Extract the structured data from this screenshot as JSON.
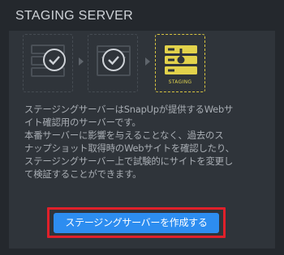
{
  "header": {
    "title": "STAGING SERVER"
  },
  "steps": [
    {
      "label": "",
      "state": "done"
    },
    {
      "label": "",
      "state": "done"
    },
    {
      "label": "STAGING",
      "state": "current"
    }
  ],
  "description": "ステージングサーバーはSnapUpが提供するWebサ\nイト確認用のサーバーです。\n本番サーバーに影響を与えることなく、過去のス\nナップショット取得時のWebサイトを確認したり、\nステージングサーバー上で試験的にサイトを変更し\nて検証することができます。",
  "actions": {
    "create_button_label": "ステージングサーバーを作成する"
  },
  "colors": {
    "accent": "#2d8df0",
    "highlight_outline": "#e0202a",
    "current_step": "#d8c440"
  }
}
